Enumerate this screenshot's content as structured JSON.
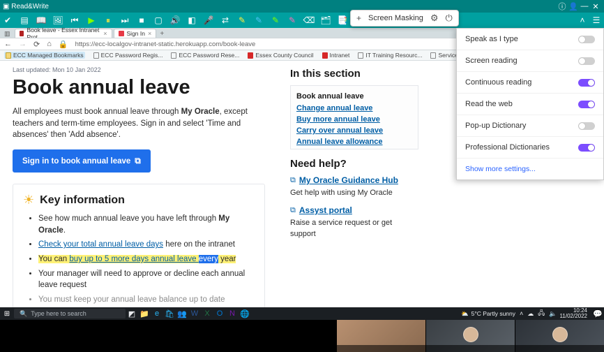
{
  "rw": {
    "title": "Read&Write",
    "sm_label": "Screen Masking"
  },
  "tabs": {
    "t1": "Book leave - Essex Intranet Prot",
    "t2": "Sign In"
  },
  "url": "https://ecc-localgov-intranet-static.herokuapp.com/book-leave",
  "bookmarks": {
    "b1": "ECC Managed Bookmarks",
    "b2": "ECC Password Regis...",
    "b3": "ECC Password Rese...",
    "b4": "Essex County Council",
    "b5": "Intranet",
    "b6": "IT Training Resourc...",
    "b7": "Service Desk"
  },
  "page": {
    "last_updated": "Last updated: Mon 10 Jan 2022",
    "h1": "Book annual leave",
    "intro_pre": "All employees must book annual leave through ",
    "intro_bold": "My Oracle",
    "intro_post": ", except teachers and term-time employees. Sign in and select 'Time and absences' then 'Add absence'.",
    "signin_btn": "Sign in to book annual leave",
    "key_title": "Key information",
    "li1_pre": "See how much annual leave you have left through ",
    "li1_bold": "My Oracle",
    "li2_link": "Check your total annual leave days",
    "li2_post": " here on the intranet",
    "li3_pre": "You can ",
    "li3_link": "buy up to 5 more days annual leave ",
    "li3_hl": "every",
    "li3_post": " year",
    "li4": "Your manager will need to approve or decline each annual leave request",
    "li5": "You must keep your annual leave balance up to date"
  },
  "side": {
    "in_section": "In this section",
    "s1": "Book annual leave",
    "s2": "Change annual leave",
    "s3": "Buy more annual leave",
    "s4": "Carry over annual leave",
    "s5": "Annual leave allowance",
    "need_help": "Need help?",
    "h1": "My Oracle Guidance Hub",
    "h1_sub": "Get help with using My Oracle",
    "h2": "Assyst portal",
    "h2_sub": "Raise a service request or get support"
  },
  "settings": {
    "r1": "Speak as I type",
    "r2": "Screen reading",
    "r3": "Continuous reading",
    "r4": "Read the web",
    "r5": "Pop-up Dictionary",
    "r6": "Professional Dictionaries",
    "more": "Show more settings..."
  },
  "taskbar": {
    "search_ph": "Type here to search",
    "weather": "5°C  Partly sunny",
    "time": "10:24",
    "date": "11/02/2022"
  }
}
